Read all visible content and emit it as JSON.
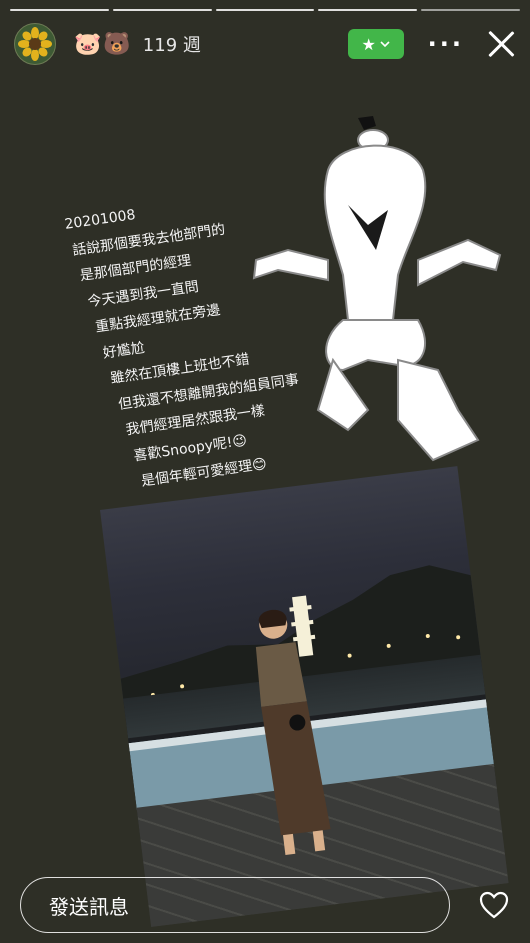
{
  "story": {
    "progress_segments": 5,
    "active_segment": 4
  },
  "header": {
    "avatar_icon": "sunflower-avatar",
    "emojis": "🐷🐻",
    "weeks": "119 週",
    "star_button_label": "★",
    "star_button_color": "#42b649",
    "more_icon": "more-icon",
    "close_icon": "close-icon"
  },
  "caption": {
    "lines": [
      "20201008",
      "話說那個要我去他部門的",
      "是那個部門的經理",
      "今天遇到我一直問",
      "重點我經理就在旁邊",
      "好尷尬",
      "雖然在頂樓上班也不錯",
      "但我還不想離開我的組員同事",
      "我們經理居然跟我一樣",
      "喜歡Snoopy呢!😉",
      "是個年輕可愛經理😊"
    ]
  },
  "sticker": {
    "icon": "snoopy-dancing-sticker"
  },
  "photo": {
    "subject": "night-scene-photo"
  },
  "footer": {
    "message_placeholder": "發送訊息",
    "heart_icon": "heart-icon"
  }
}
